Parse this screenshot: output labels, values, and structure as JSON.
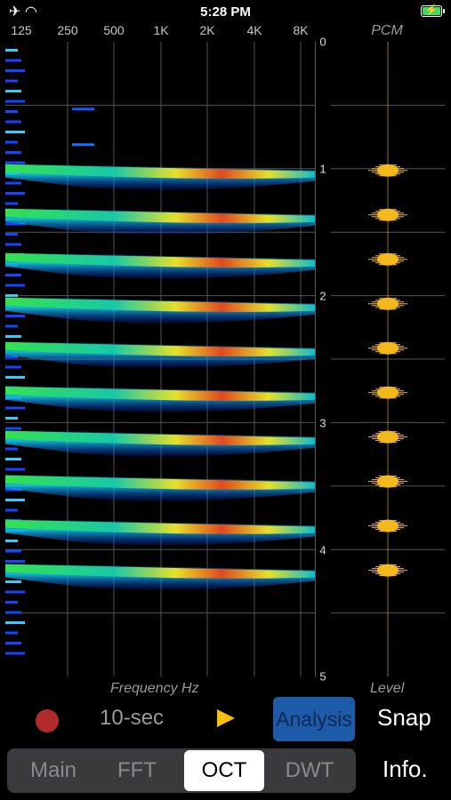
{
  "status_bar": {
    "time": "5:28 PM"
  },
  "frequency_ticks": [
    "125",
    "250",
    "500",
    "1K",
    "2K",
    "4K",
    "8K"
  ],
  "time_ticks": [
    "0",
    "1",
    "2",
    "3",
    "4",
    "5"
  ],
  "pcm_title": "PCM",
  "x_axis_label": "Frequency Hz",
  "level_label": "Level",
  "controls": {
    "duration": "10-sec",
    "analysis": "Analysis",
    "snap": "Snap"
  },
  "tabs": [
    {
      "label": "Main",
      "selected": false
    },
    {
      "label": "FFT",
      "selected": false
    },
    {
      "label": "OCT",
      "selected": true
    },
    {
      "label": "DWT",
      "selected": false
    }
  ],
  "info_label": "Info.",
  "colors": {
    "accent_blue": "#1d5aa7",
    "play_yellow": "#f5bf10",
    "record_red": "#b12b2b",
    "pcm_gold": "#f3b81c"
  },
  "spectrogram": {
    "burst_times_sec": [
      1.0,
      1.35,
      1.7,
      2.05,
      2.4,
      2.75,
      3.1,
      3.45,
      3.8,
      4.15
    ],
    "time_range": [
      0,
      5
    ]
  }
}
